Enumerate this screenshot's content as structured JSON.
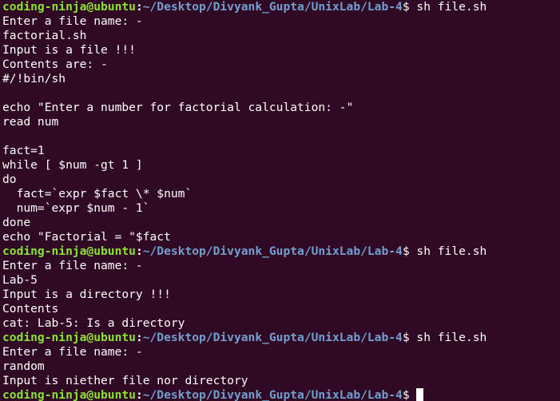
{
  "prompt": {
    "user_host": "coding-ninja@ubuntu",
    "separator": ":",
    "path": "~/Desktop/Divyank_Gupta/UnixLab/Lab-4",
    "symbol": "$"
  },
  "lines": [
    {
      "type": "prompt",
      "command": " sh file.sh"
    },
    {
      "type": "output",
      "text": "Enter a file name: -"
    },
    {
      "type": "output",
      "text": "factorial.sh"
    },
    {
      "type": "output",
      "text": "Input is a file !!!"
    },
    {
      "type": "output",
      "text": "Contents are: -"
    },
    {
      "type": "output",
      "text": "#/!bin/sh"
    },
    {
      "type": "output",
      "text": ""
    },
    {
      "type": "output",
      "text": "echo \"Enter a number for factorial calculation: -\""
    },
    {
      "type": "output",
      "text": "read num"
    },
    {
      "type": "output",
      "text": ""
    },
    {
      "type": "output",
      "text": "fact=1"
    },
    {
      "type": "output",
      "text": "while [ $num -gt 1 ]"
    },
    {
      "type": "output",
      "text": "do"
    },
    {
      "type": "output",
      "text": "  fact=`expr $fact \\* $num`"
    },
    {
      "type": "output",
      "text": "  num=`expr $num - 1`"
    },
    {
      "type": "output",
      "text": "done"
    },
    {
      "type": "output",
      "text": "echo \"Factorial = \"$fact"
    },
    {
      "type": "prompt",
      "command": " sh file.sh"
    },
    {
      "type": "output",
      "text": "Enter a file name: -"
    },
    {
      "type": "output",
      "text": "Lab-5"
    },
    {
      "type": "output",
      "text": "Input is a directory !!!"
    },
    {
      "type": "output",
      "text": "Contents"
    },
    {
      "type": "output",
      "text": "cat: Lab-5: Is a directory"
    },
    {
      "type": "prompt",
      "command": " sh file.sh"
    },
    {
      "type": "output",
      "text": "Enter a file name: -"
    },
    {
      "type": "output",
      "text": "random"
    },
    {
      "type": "output",
      "text": "Input is niether file nor directory"
    },
    {
      "type": "prompt",
      "command": " ",
      "cursor": true
    }
  ],
  "colors": {
    "background": "#300a24",
    "text": "#ffffff",
    "user_host": "#8ae234",
    "path": "#729fcf"
  }
}
